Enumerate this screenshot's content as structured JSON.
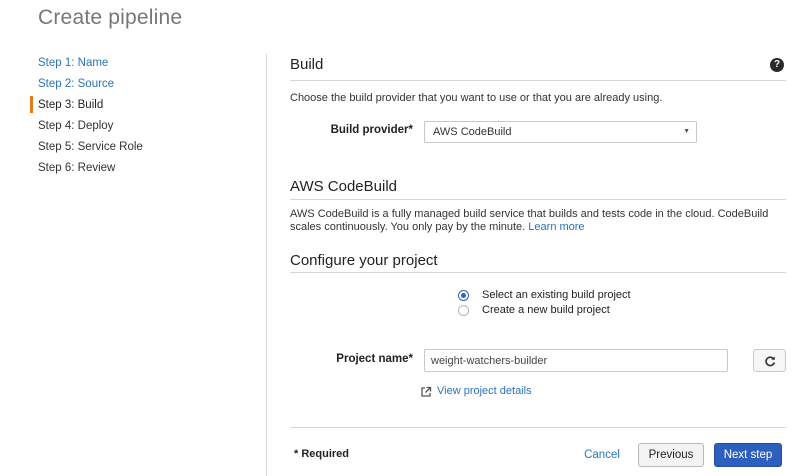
{
  "page": {
    "title": "Create pipeline"
  },
  "steps": [
    {
      "label": "Step 1: Name"
    },
    {
      "label": "Step 2: Source"
    },
    {
      "label": "Step 3: Build"
    },
    {
      "label": "Step 4: Deploy"
    },
    {
      "label": "Step 5: Service Role"
    },
    {
      "label": "Step 6: Review"
    }
  ],
  "build": {
    "title": "Build",
    "help_icon": "?",
    "description": "Choose the build provider that you want to use or that you are already using.",
    "provider_label": "Build provider*",
    "provider_value": "AWS CodeBuild"
  },
  "codebuild": {
    "title": "AWS CodeBuild",
    "description": "AWS CodeBuild is a fully managed build service that builds and tests code in the cloud. CodeBuild scales continuously. You only pay by the minute.",
    "learn_more": "Learn more"
  },
  "configure": {
    "title": "Configure your project",
    "options": [
      {
        "label": "Select an existing build project",
        "selected": true
      },
      {
        "label": "Create a new build project",
        "selected": false
      }
    ],
    "project_label": "Project name*",
    "project_value": "weight-watchers-builder",
    "view_details": "View project details"
  },
  "footer": {
    "required_note": "* Required",
    "cancel": "Cancel",
    "previous": "Previous",
    "next": "Next step"
  },
  "colors": {
    "link": "#2a73b8",
    "active_marker": "#e07b16",
    "primary": "#2d5fbf"
  }
}
